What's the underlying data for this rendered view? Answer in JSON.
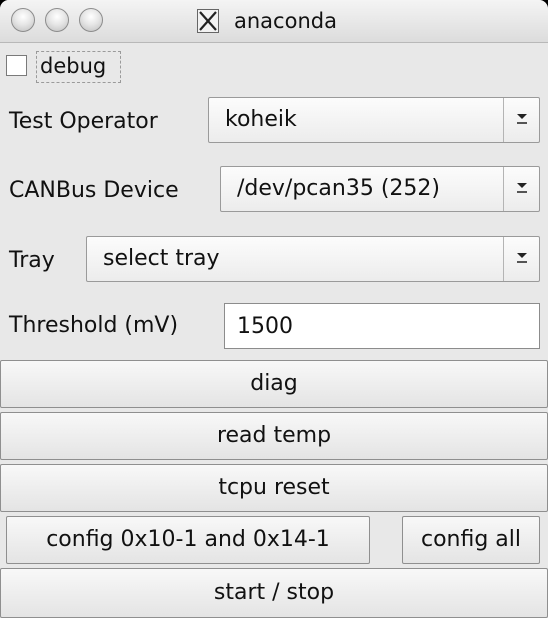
{
  "window": {
    "title": "anaconda",
    "title_icon": "x11-icon",
    "controls": [
      "close-button",
      "minimize-button",
      "zoom-button"
    ]
  },
  "debug": {
    "label": "debug",
    "checked": false
  },
  "test_operator": {
    "label": "Test Operator",
    "selected": "koheik"
  },
  "canbus_device": {
    "label": "CANBus Device",
    "selected": "/dev/pcan35 (252)"
  },
  "tray": {
    "label": "Tray",
    "selected": "select tray"
  },
  "threshold": {
    "label": "Threshold (mV)",
    "value": "1500"
  },
  "buttons": {
    "diag": "diag",
    "read_temp": "read temp",
    "tcpu_reset": "tcpu reset",
    "config_pair": "config 0x10-1 and 0x14-1",
    "config_all": "config all",
    "start_stop": "start / stop"
  }
}
